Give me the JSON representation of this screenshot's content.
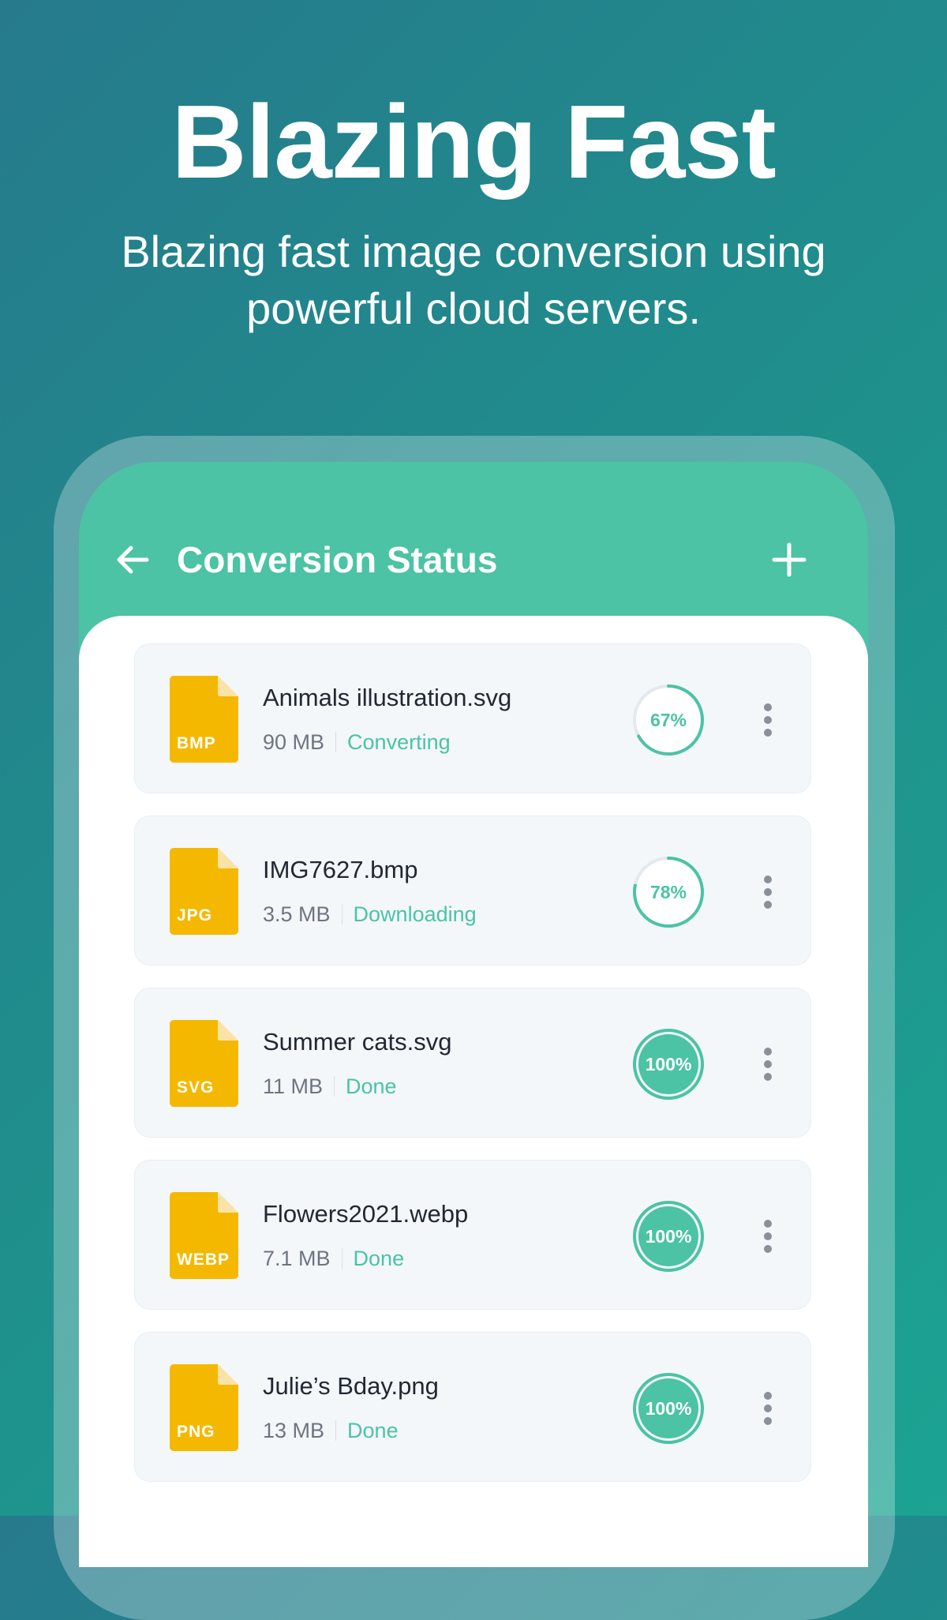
{
  "hero": {
    "title": "Blazing Fast",
    "subtitle": "Blazing fast image conversion using powerful cloud servers."
  },
  "app_bar": {
    "back_icon": "arrow-left-icon",
    "title": "Conversion Status",
    "add_icon": "plus-icon"
  },
  "colors": {
    "accent": "#4bc3a4",
    "file_icon": "#f5b800",
    "background_start": "#267a8c",
    "background_end": "#1ca392"
  },
  "files": [
    {
      "ext": "BMP",
      "name": "Animals illustration.svg",
      "size": "90 MB",
      "status": "Converting",
      "progress_label": "67%",
      "progress": 0.67
    },
    {
      "ext": "JPG",
      "name": "IMG7627.bmp",
      "size": "3.5 MB",
      "status": "Downloading",
      "progress_label": "78%",
      "progress": 0.78
    },
    {
      "ext": "SVG",
      "name": "Summer cats.svg",
      "size": "11 MB",
      "status": "Done",
      "progress_label": "100%",
      "progress": 1.0
    },
    {
      "ext": "WEBP",
      "name": "Flowers2021.webp",
      "size": "7.1 MB",
      "status": "Done",
      "progress_label": "100%",
      "progress": 1.0
    },
    {
      "ext": "PNG",
      "name": "Julie’s Bday.png",
      "size": "13 MB",
      "status": "Done",
      "progress_label": "100%",
      "progress": 1.0
    }
  ]
}
